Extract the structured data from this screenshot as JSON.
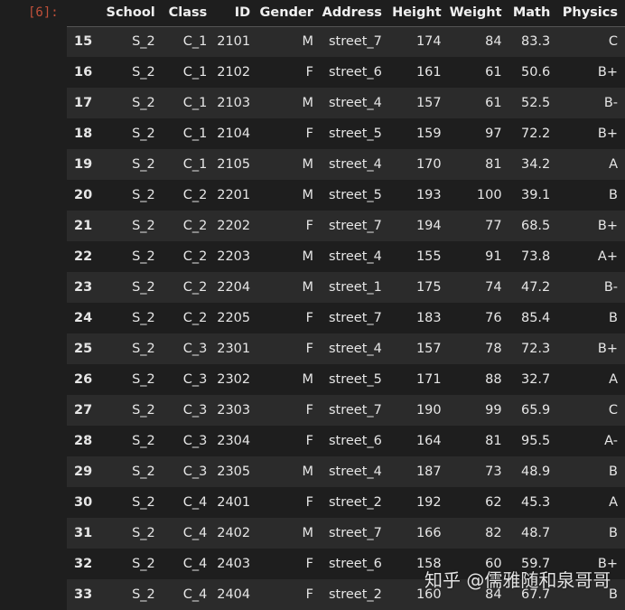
{
  "prompt": "[6]:",
  "columns": [
    "School",
    "Class",
    "ID",
    "Gender",
    "Address",
    "Height",
    "Weight",
    "Math",
    "Physics"
  ],
  "rows": [
    {
      "index": "15",
      "cells": [
        "S_2",
        "C_1",
        "2101",
        "M",
        "street_7",
        "174",
        "84",
        "83.3",
        "C"
      ]
    },
    {
      "index": "16",
      "cells": [
        "S_2",
        "C_1",
        "2102",
        "F",
        "street_6",
        "161",
        "61",
        "50.6",
        "B+"
      ]
    },
    {
      "index": "17",
      "cells": [
        "S_2",
        "C_1",
        "2103",
        "M",
        "street_4",
        "157",
        "61",
        "52.5",
        "B-"
      ]
    },
    {
      "index": "18",
      "cells": [
        "S_2",
        "C_1",
        "2104",
        "F",
        "street_5",
        "159",
        "97",
        "72.2",
        "B+"
      ]
    },
    {
      "index": "19",
      "cells": [
        "S_2",
        "C_1",
        "2105",
        "M",
        "street_4",
        "170",
        "81",
        "34.2",
        "A"
      ]
    },
    {
      "index": "20",
      "cells": [
        "S_2",
        "C_2",
        "2201",
        "M",
        "street_5",
        "193",
        "100",
        "39.1",
        "B"
      ]
    },
    {
      "index": "21",
      "cells": [
        "S_2",
        "C_2",
        "2202",
        "F",
        "street_7",
        "194",
        "77",
        "68.5",
        "B+"
      ]
    },
    {
      "index": "22",
      "cells": [
        "S_2",
        "C_2",
        "2203",
        "M",
        "street_4",
        "155",
        "91",
        "73.8",
        "A+"
      ]
    },
    {
      "index": "23",
      "cells": [
        "S_2",
        "C_2",
        "2204",
        "M",
        "street_1",
        "175",
        "74",
        "47.2",
        "B-"
      ]
    },
    {
      "index": "24",
      "cells": [
        "S_2",
        "C_2",
        "2205",
        "F",
        "street_7",
        "183",
        "76",
        "85.4",
        "B"
      ]
    },
    {
      "index": "25",
      "cells": [
        "S_2",
        "C_3",
        "2301",
        "F",
        "street_4",
        "157",
        "78",
        "72.3",
        "B+"
      ]
    },
    {
      "index": "26",
      "cells": [
        "S_2",
        "C_3",
        "2302",
        "M",
        "street_5",
        "171",
        "88",
        "32.7",
        "A"
      ]
    },
    {
      "index": "27",
      "cells": [
        "S_2",
        "C_3",
        "2303",
        "F",
        "street_7",
        "190",
        "99",
        "65.9",
        "C"
      ]
    },
    {
      "index": "28",
      "cells": [
        "S_2",
        "C_3",
        "2304",
        "F",
        "street_6",
        "164",
        "81",
        "95.5",
        "A-"
      ]
    },
    {
      "index": "29",
      "cells": [
        "S_2",
        "C_3",
        "2305",
        "M",
        "street_4",
        "187",
        "73",
        "48.9",
        "B"
      ]
    },
    {
      "index": "30",
      "cells": [
        "S_2",
        "C_4",
        "2401",
        "F",
        "street_2",
        "192",
        "62",
        "45.3",
        "A"
      ]
    },
    {
      "index": "31",
      "cells": [
        "S_2",
        "C_4",
        "2402",
        "M",
        "street_7",
        "166",
        "82",
        "48.7",
        "B"
      ]
    },
    {
      "index": "32",
      "cells": [
        "S_2",
        "C_4",
        "2403",
        "F",
        "street_6",
        "158",
        "60",
        "59.7",
        "B+"
      ]
    },
    {
      "index": "33",
      "cells": [
        "S_2",
        "C_4",
        "2404",
        "F",
        "street_2",
        "160",
        "84",
        "67.7",
        "B"
      ]
    }
  ],
  "watermark": "知乎 @儒雅随和泉哥哥"
}
